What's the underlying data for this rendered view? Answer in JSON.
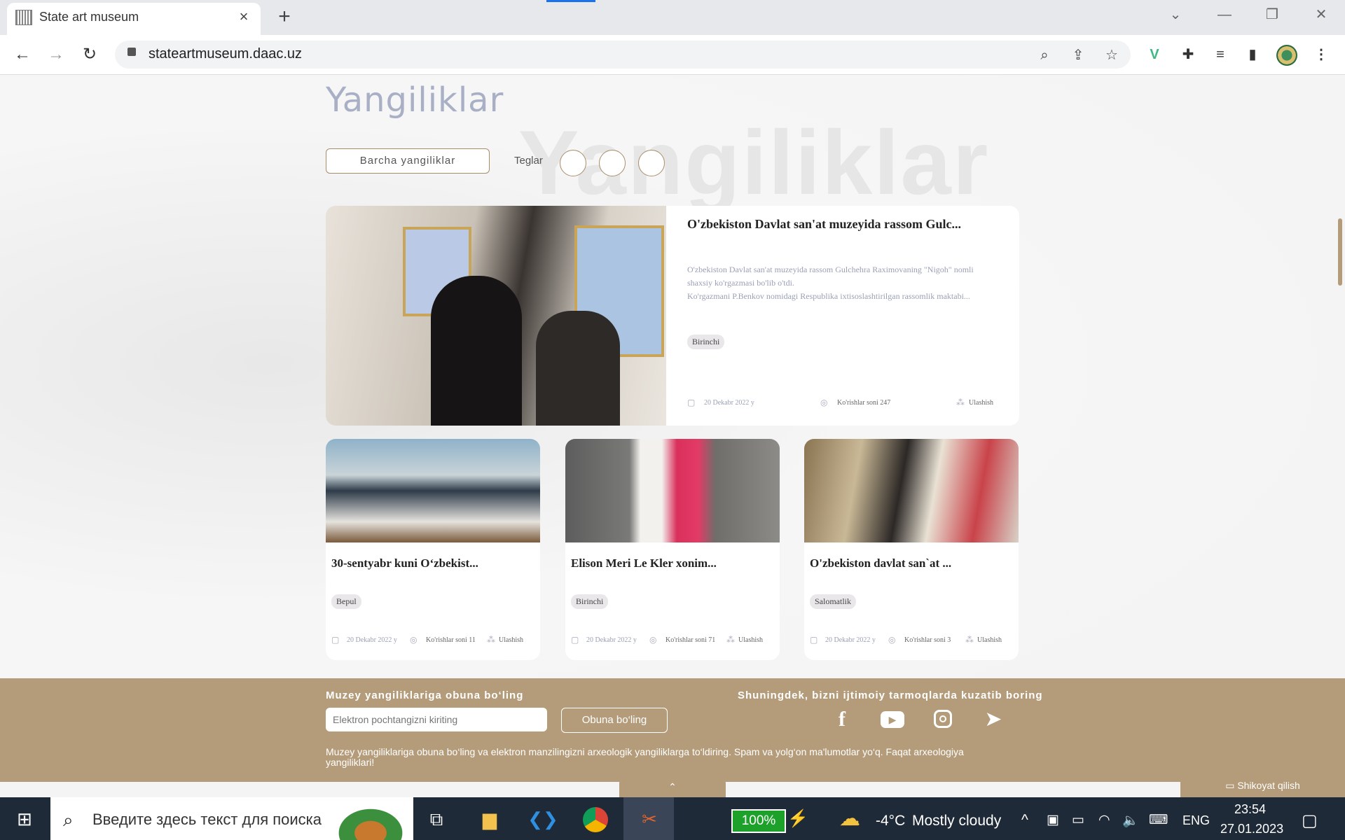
{
  "browser": {
    "tab_title": "State art museum",
    "tab_close": "×",
    "new_tab": "+",
    "url": "stateartmuseum.daac.uz",
    "back": "←",
    "forward": "→",
    "reload": "↻",
    "win_ctrl": [
      "⌄",
      "—",
      "❐",
      "✕"
    ]
  },
  "page": {
    "bg_word": "Yangiliklar",
    "title": "Yangiliklar",
    "filter_all": "Barcha yangiliklar",
    "tags_label": "Teglar"
  },
  "featured": {
    "title": "O'zbekiston Davlat san'at muzeyida rassom Gulc...",
    "desc_line1": "O'zbekiston Davlat san'at muzeyida rassom Gulchehra Raximovaning \"Nigoh\" nomli",
    "desc_line2": "shaxsiy ko'rgazmasi bo'lib o'tdi.",
    "desc_line3": "Ko'rgazmani P.Benkov nomidagi Respublika ixtisoslashtirilgan rassomlik maktabi...",
    "badge": "Birinchi",
    "date": "20 Dekabr 2022 y",
    "views": "Ko'rishlar soni 247",
    "share": "Ulashish"
  },
  "news": [
    {
      "title": "30-sentyabr kuni O‘zbekist...",
      "badge": "Bepul",
      "date": "20 Dekabr 2022 y",
      "views": "Ko'rishlar soni 11",
      "share": "Ulashish"
    },
    {
      "title": "Elison Meri Le Kler xonim...",
      "badge": "Birinchi",
      "date": "20 Dekabr 2022 y",
      "views": "Ko'rishlar soni 71",
      "share": "Ulashish"
    },
    {
      "title": "O'zbekiston davlat san`at ...",
      "badge": "Salomatlik",
      "date": "20 Dekabr 2022 y",
      "views": "Ko'rishlar soni 3",
      "share": "Ulashish"
    }
  ],
  "footer": {
    "subscribe_heading": "Muzey yangiliklariga obuna bo‘ling",
    "email_placeholder": "Elektron pochtangizni kiriting",
    "subscribe_button": "Obuna bo‘ling",
    "social_heading": "Shuningdek, bizni ijtimoiy tarmoqlarda kuzatib boring",
    "note": "Muzey yangiliklariga obuna bo‘ling va elektron manzilingizni arxeologik yangiliklarga to‘ldiring. Spam va yolg‘on ma'lumotlar yo‘q. Faqat arxeologiya yangiliklari!",
    "complaint": "Shikoyat qilish",
    "up": "⌃"
  },
  "taskbar": {
    "search_placeholder": "Введите здесь текст для поиска",
    "battery": "100%",
    "temperature": "-4°C",
    "weather": "Mostly cloudy",
    "language": "ENG",
    "time": "23:54",
    "date": "27.01.2023"
  },
  "colors": {
    "accent": "#b49c7a",
    "title_muted": "#a9b0c6",
    "taskbar": "#1f2a38"
  }
}
